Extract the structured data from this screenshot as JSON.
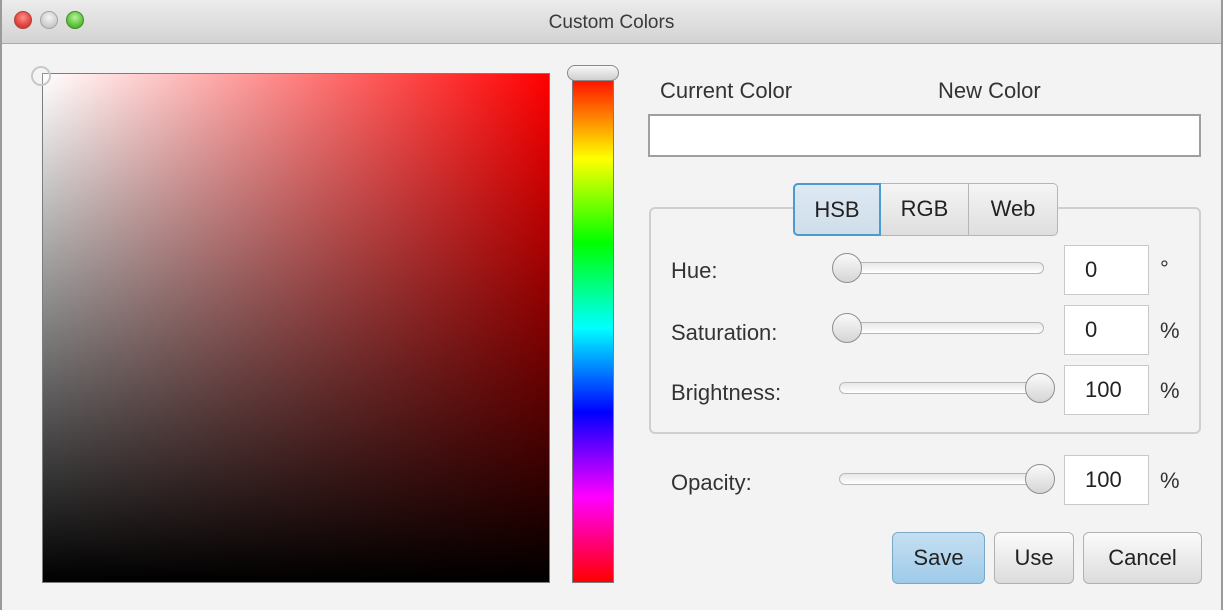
{
  "window": {
    "title": "Custom Colors"
  },
  "colors": {
    "hue_handle_color": "#ff0000",
    "selected_tab_border": "#4b9bd0",
    "save_button_bg": "#a9d2ee"
  },
  "labels": {
    "current_color": "Current Color",
    "new_color": "New Color"
  },
  "tabs": [
    {
      "label": "HSB",
      "selected": true
    },
    {
      "label": "RGB",
      "selected": false
    },
    {
      "label": "Web",
      "selected": false
    }
  ],
  "fields": {
    "hue": {
      "label": "Hue:",
      "value": "0",
      "unit": "°",
      "level": 0
    },
    "saturation": {
      "label": "Saturation:",
      "value": "0",
      "unit": "%",
      "level": 0
    },
    "brightness": {
      "label": "Brightness:",
      "value": "100",
      "unit": "%",
      "level": 1
    },
    "opacity": {
      "label": "Opacity:",
      "value": "100",
      "unit": "%",
      "level": 1
    }
  },
  "buttons": {
    "save": "Save",
    "use": "Use",
    "cancel": "Cancel"
  },
  "icons": {
    "close": "close-dot-icon",
    "minimize": "minimize-dot-icon",
    "zoom": "zoom-dot-icon"
  }
}
